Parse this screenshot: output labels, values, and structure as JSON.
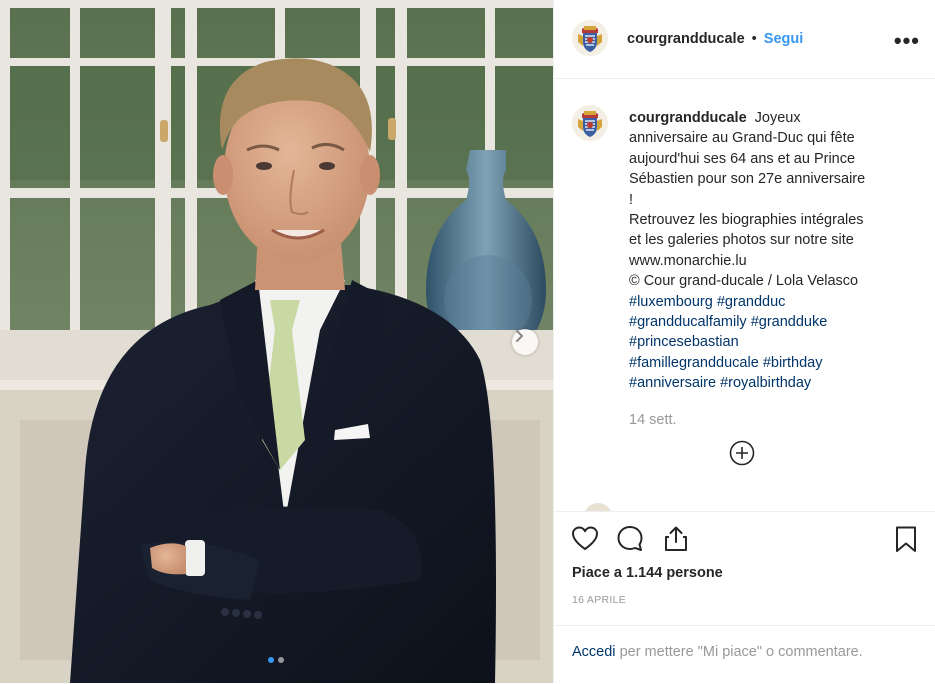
{
  "post": {
    "username": "courgrandducale",
    "separator": "•",
    "follow_label": "Segui",
    "more_label": "•••"
  },
  "caption": {
    "username": "courgrandducale",
    "text_lines": [
      "Joyeux",
      "anniversaire au Grand-Duc qui fête",
      "aujourd'hui ses 64 ans et au Prince",
      "Sébastien pour son 27e anniversaire",
      "!",
      "Retrouvez les biographies intégrales",
      "et les galeries photos sur notre site",
      "www.monarchie.lu",
      "© Cour grand-ducale / Lola Velasco"
    ],
    "hashtags": [
      "#luxembourg",
      "#grandduc",
      "#grandducalfamily",
      "#grandduke",
      "#princesebastian",
      "#famillegrandducale",
      "#birthday",
      "#anniversaire",
      "#royalbirthday"
    ],
    "time_ago": "14 sett."
  },
  "icons": {
    "like": "heart-icon",
    "comment": "comment-bubble-icon",
    "share": "share-icon",
    "save": "bookmark-icon",
    "load_more": "plus-circle-icon",
    "next": "chevron-right-icon"
  },
  "likes_text": "Piace a 1.144 persone",
  "post_date": "16 APRILE",
  "login": {
    "link_label": "Accedi",
    "rest_text": "per mettere \"Mi piace\" o commentare."
  },
  "carousel": {
    "total": 2,
    "current": 1
  },
  "colors": {
    "link_blue": "#3897f0",
    "hashtag_blue": "#003569",
    "muted_gray": "#999999"
  }
}
